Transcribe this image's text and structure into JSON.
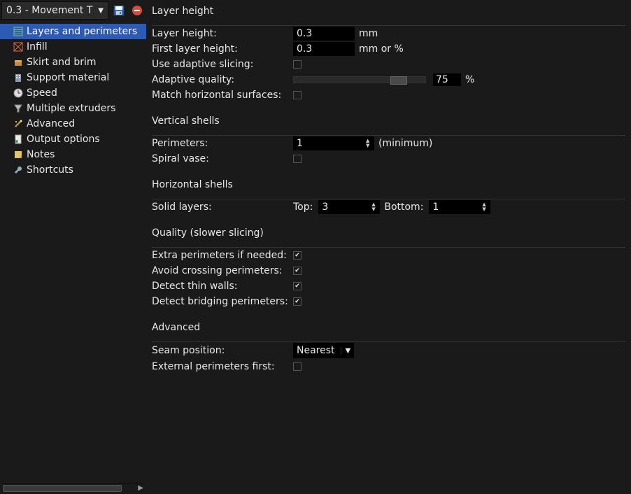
{
  "profile_name": "0.3 - Movement T",
  "sidebar": {
    "items": [
      {
        "label": "Layers and perimeters",
        "icon": "layers",
        "selected": true
      },
      {
        "label": "Infill",
        "icon": "infill",
        "selected": false
      },
      {
        "label": "Skirt and brim",
        "icon": "skirt",
        "selected": false
      },
      {
        "label": "Support material",
        "icon": "support",
        "selected": false
      },
      {
        "label": "Speed",
        "icon": "speed",
        "selected": false
      },
      {
        "label": "Multiple extruders",
        "icon": "funnel",
        "selected": false
      },
      {
        "label": "Advanced",
        "icon": "wand",
        "selected": false
      },
      {
        "label": "Output options",
        "icon": "output",
        "selected": false
      },
      {
        "label": "Notes",
        "icon": "notes",
        "selected": false
      },
      {
        "label": "Shortcuts",
        "icon": "wrench",
        "selected": false
      }
    ]
  },
  "groups": {
    "layer_height": {
      "title": "Layer height",
      "layer_height_label": "Layer height:",
      "layer_height_value": "0.3",
      "layer_height_unit": "mm",
      "first_layer_label": "First layer height:",
      "first_layer_value": "0.3",
      "first_layer_unit": "mm or %",
      "adaptive_label": "Use adaptive slicing:",
      "adaptive_checked": false,
      "quality_label": "Adaptive quality:",
      "quality_value": "75",
      "quality_unit": "%",
      "match_label": "Match horizontal surfaces:",
      "match_checked": false
    },
    "vertical": {
      "title": "Vertical shells",
      "perimeters_label": "Perimeters:",
      "perimeters_value": "1",
      "perimeters_note": "(minimum)",
      "spiral_label": "Spiral vase:",
      "spiral_checked": false
    },
    "horizontal": {
      "title": "Horizontal shells",
      "solid_label": "Solid layers:",
      "top_label": "Top:",
      "top_value": "3",
      "bottom_label": "Bottom:",
      "bottom_value": "1"
    },
    "quality": {
      "title": "Quality (slower slicing)",
      "extra_label": "Extra perimeters if needed:",
      "extra_checked": true,
      "avoid_label": "Avoid crossing perimeters:",
      "avoid_checked": true,
      "thin_label": "Detect thin walls:",
      "thin_checked": true,
      "bridging_label": "Detect bridging perimeters:",
      "bridging_checked": true
    },
    "advanced": {
      "title": "Advanced",
      "seam_label": "Seam position:",
      "seam_value": "Nearest",
      "external_label": "External perimeters first:",
      "external_checked": false
    }
  }
}
